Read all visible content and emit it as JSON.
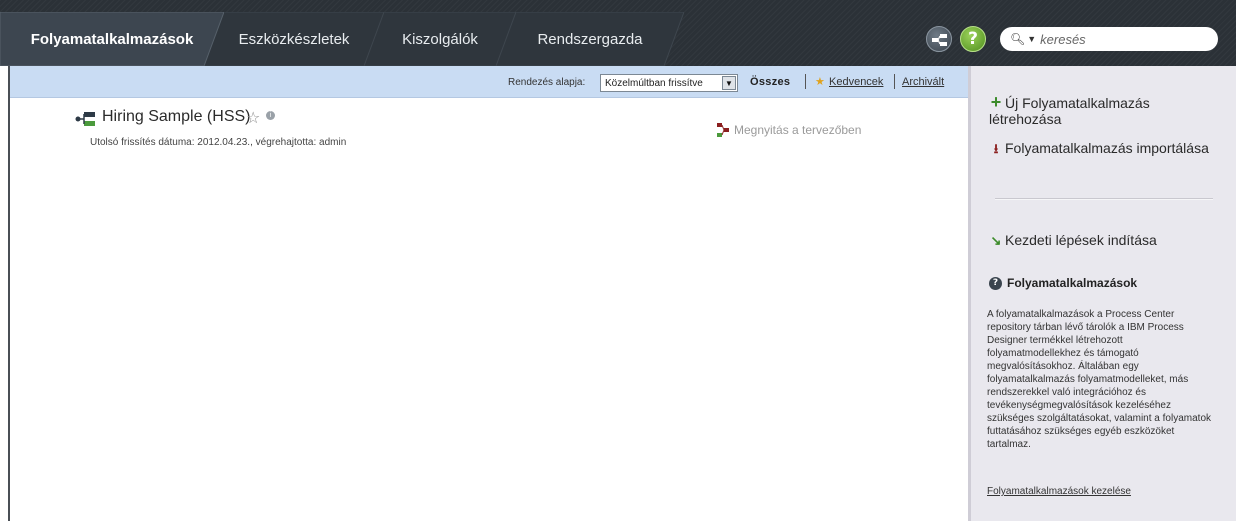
{
  "nav": {
    "tabs": [
      {
        "label": "Folyamatalkalmazások",
        "active": true
      },
      {
        "label": "Eszközkészletek",
        "active": false
      },
      {
        "label": "Kiszolgálók",
        "active": false
      },
      {
        "label": "Rendszergazda",
        "active": false
      }
    ],
    "help_glyph": "?",
    "search_placeholder": "keresés"
  },
  "sortbar": {
    "label": "Rendezés alapja:",
    "selected": "Közelmúltban frissítve",
    "filter_all": "Összes",
    "filter_favorites": "Kedvencek",
    "filter_archived": "Archivált"
  },
  "app": {
    "title": "Hiring Sample (HSS)",
    "meta": "Utolsó frissítés dátuma: 2012.04.23., végrehajtotta: admin",
    "open_designer": "Megnyitás a tervezőben"
  },
  "sidebar": {
    "new_app": "Új Folyamatalkalmazás létrehozása",
    "import_app": "Folyamatalkalmazás importálása",
    "getting_started": "Kezdeti lépések indítása",
    "help_title": "Folyamatalkalmazások",
    "help_text": "A folyamatalkalmazások a Process Center repository tárban lévő tárolók a IBM Process Designer termékkel létrehozott folyamatmodellekhez és támogató megvalósításokhoz. Általában egy folyamatalkalmazás folyamatmodelleket, más rendszerekkel való integrációhoz és tevékenységmegvalósítások kezeléséhez szükséges szolgáltatásokat, valamint a folyamatok futtatásához szükséges egyéb eszközöket tartalmaz.",
    "manage_link": "Folyamatalkalmazások kezelése"
  },
  "colors": {
    "nav_bg": "#2b3137",
    "active_tab": "#3d4650",
    "sortbar_bg": "#c9dcf3",
    "sidebar_bg": "#e9e8ee"
  }
}
